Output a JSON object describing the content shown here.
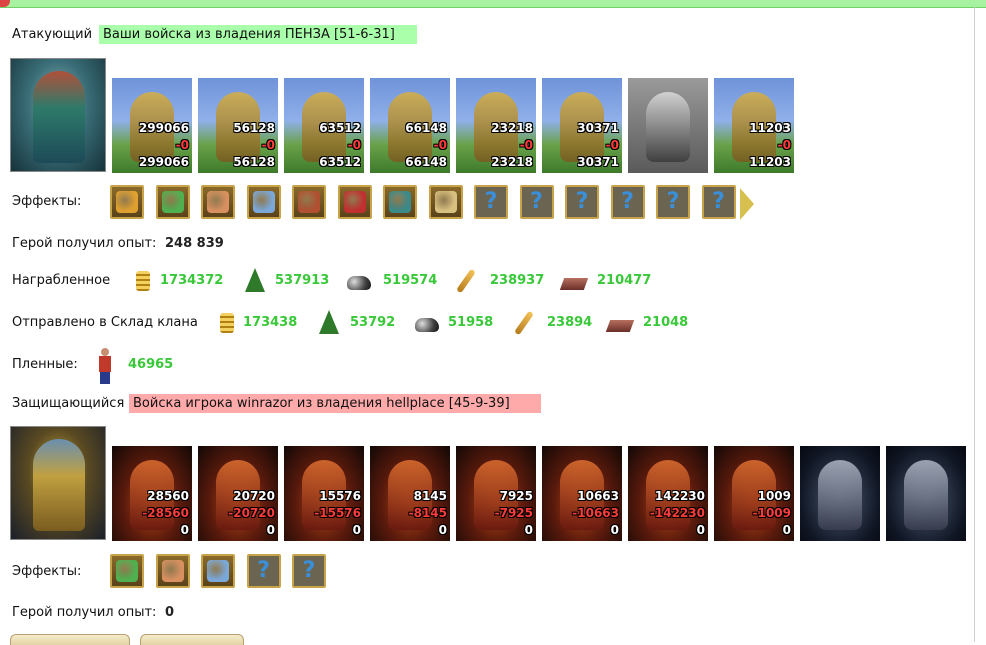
{
  "attacker": {
    "label": "Атакующий",
    "banner": "Ваши войска из владения ПЕНЗА [51-6-31]",
    "units": [
      {
        "total": "299066",
        "loss": "-0",
        "remain": "299066"
      },
      {
        "total": "56128",
        "loss": "-0",
        "remain": "56128"
      },
      {
        "total": "63512",
        "loss": "-0",
        "remain": "63512"
      },
      {
        "total": "66148",
        "loss": "-0",
        "remain": "66148"
      },
      {
        "total": "23218",
        "loss": "-0",
        "remain": "23218"
      },
      {
        "total": "30371",
        "loss": "-0",
        "remain": "30371"
      },
      {
        "total": "",
        "loss": "",
        "remain": ""
      },
      {
        "total": "11203",
        "loss": "-0",
        "remain": "11203"
      }
    ],
    "effects_label": "Эффекты:",
    "effects": [
      "coins-icon",
      "sword-icon",
      "handshake-icon",
      "hand-icon",
      "shield-swirl-icon",
      "dice-icon",
      "shield-icon",
      "scroll-icon",
      "unknown",
      "unknown",
      "unknown",
      "unknown",
      "unknown",
      "unknown"
    ],
    "xp_label": "Герой получил опыт:",
    "xp_value": "248 839",
    "loot_label": "Награбленное",
    "loot": {
      "gold": "1734372",
      "wood": "537913",
      "ore": "519574",
      "grain": "238937",
      "brick": "210477"
    },
    "clan_label": "Отправлено в Склад клана",
    "clan": {
      "gold": "173438",
      "wood": "53792",
      "ore": "51958",
      "grain": "23894",
      "brick": "21048"
    },
    "prisoners_label": "Пленные:",
    "prisoners_value": "46965"
  },
  "defender": {
    "label": "Защищающийся",
    "banner": "Войска игрока winrazor из владения hellplace [45-9-39]",
    "units": [
      {
        "total": "28560",
        "loss": "-28560",
        "remain": "0"
      },
      {
        "total": "20720",
        "loss": "-20720",
        "remain": "0"
      },
      {
        "total": "15576",
        "loss": "-15576",
        "remain": "0"
      },
      {
        "total": "8145",
        "loss": "-8145",
        "remain": "0"
      },
      {
        "total": "7925",
        "loss": "-7925",
        "remain": "0"
      },
      {
        "total": "10663",
        "loss": "-10663",
        "remain": "0"
      },
      {
        "total": "142230",
        "loss": "-142230",
        "remain": "0"
      },
      {
        "total": "1009",
        "loss": "-1009",
        "remain": "0"
      },
      {
        "total": "",
        "loss": "",
        "remain": ""
      },
      {
        "total": "",
        "loss": "",
        "remain": ""
      }
    ],
    "effects_label": "Эффекты:",
    "effects": [
      "sword-icon",
      "handshake-icon",
      "hand-icon",
      "unknown",
      "unknown"
    ],
    "xp_label": "Герой получил опыт:",
    "xp_value": "0"
  },
  "colors": {
    "friendly_banner": "#aaffaa",
    "enemy_banner": "#ffaaaa",
    "resource_text": "#38c838",
    "loss_text": "#ff3b3b"
  }
}
